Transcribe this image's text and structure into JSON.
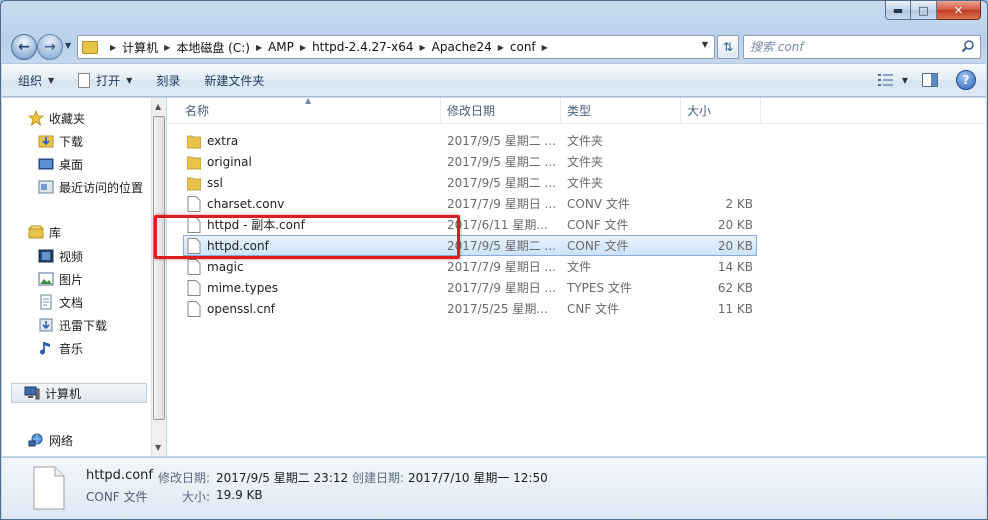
{
  "window": {
    "caption": {
      "min": "▬",
      "max": "□",
      "close": "✕"
    }
  },
  "address": {
    "crumbs": [
      "计算机",
      "本地磁盘 (C:)",
      "AMP",
      "httpd-2.4.27-x64",
      "Apache24",
      "conf"
    ],
    "search_placeholder": "搜索 conf"
  },
  "toolbar": {
    "organize": "组织",
    "open": "打开",
    "burn": "刻录",
    "new_folder": "新建文件夹"
  },
  "nav": {
    "favorites": "收藏夹",
    "downloads": "下载",
    "desktop": "桌面",
    "recent": "最近访问的位置",
    "libraries": "库",
    "videos": "视频",
    "pictures": "图片",
    "documents": "文档",
    "xunlei": "迅雷下载",
    "music": "音乐",
    "computer": "计算机",
    "network": "网络"
  },
  "columns": {
    "name": "名称",
    "date": "修改日期",
    "type": "类型",
    "size": "大小"
  },
  "files": [
    {
      "name": "extra",
      "date": "2017/9/5 星期二 ...",
      "type": "文件夹",
      "size": "",
      "kind": "folder"
    },
    {
      "name": "original",
      "date": "2017/9/5 星期二 ...",
      "type": "文件夹",
      "size": "",
      "kind": "folder"
    },
    {
      "name": "ssl",
      "date": "2017/9/5 星期二 ...",
      "type": "文件夹",
      "size": "",
      "kind": "folder"
    },
    {
      "name": "charset.conv",
      "date": "2017/7/9 星期日 ...",
      "type": "CONV 文件",
      "size": "2 KB",
      "kind": "file"
    },
    {
      "name": "httpd - 副本.conf",
      "date": "2017/6/11 星期...",
      "type": "CONF 文件",
      "size": "20 KB",
      "kind": "file"
    },
    {
      "name": "httpd.conf",
      "date": "2017/9/5 星期二 ...",
      "type": "CONF 文件",
      "size": "20 KB",
      "kind": "file",
      "selected": true
    },
    {
      "name": "magic",
      "date": "2017/7/9 星期日 ...",
      "type": "文件",
      "size": "14 KB",
      "kind": "file"
    },
    {
      "name": "mime.types",
      "date": "2017/7/9 星期日 ...",
      "type": "TYPES 文件",
      "size": "62 KB",
      "kind": "file"
    },
    {
      "name": "openssl.cnf",
      "date": "2017/5/25 星期...",
      "type": "CNF 文件",
      "size": "11 KB",
      "kind": "file"
    }
  ],
  "details": {
    "name": "httpd.conf",
    "type": "CONF 文件",
    "modified_label": "修改日期:",
    "modified_value": "2017/9/5 星期二 23:12",
    "created_label": "创建日期:",
    "created_value": "2017/7/10 星期一 12:50",
    "size_label": "大小:",
    "size_value": "19.9 KB"
  },
  "colors": {
    "highlight": "#d81e1e",
    "selection": "#cde3fa",
    "folder": "#e8c34a"
  }
}
